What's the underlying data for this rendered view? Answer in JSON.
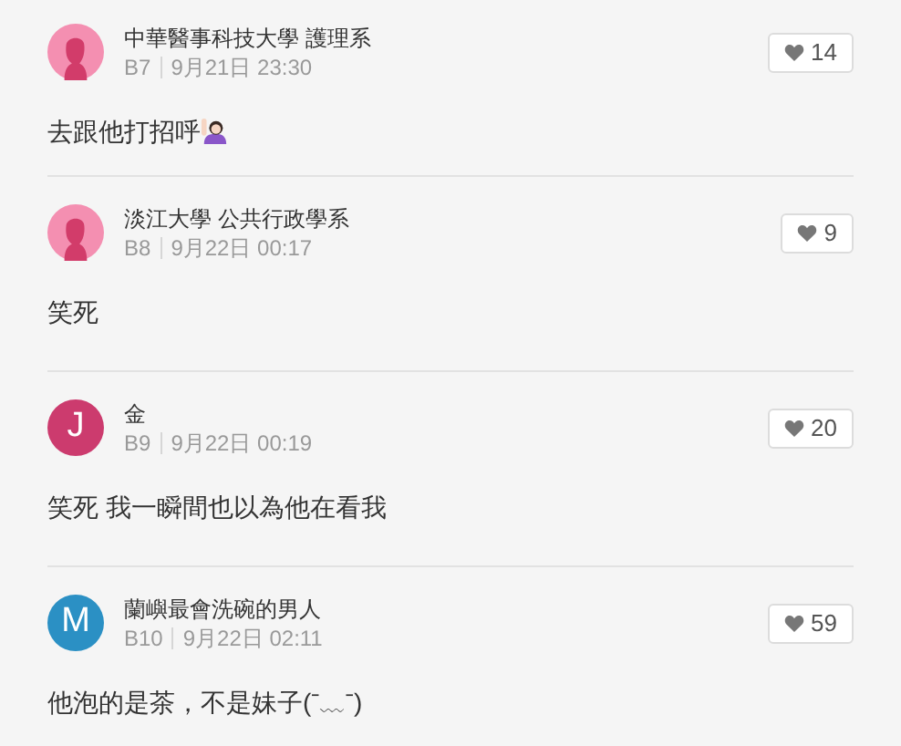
{
  "comments": [
    {
      "avatar": {
        "kind": "silhouette",
        "color": "#f48fb1"
      },
      "author": "中華醫事科技大學 護理系",
      "floor": "B7",
      "time": "9月21日 23:30",
      "likes": "14",
      "text": "去跟他打招呼",
      "has_emoji": true
    },
    {
      "avatar": {
        "kind": "silhouette",
        "color": "#f48fb1"
      },
      "author": "淡江大學 公共行政學系",
      "floor": "B8",
      "time": "9月22日 00:17",
      "likes": "9",
      "text": "笑死"
    },
    {
      "avatar": {
        "kind": "letter",
        "letter": "J",
        "color": "#cc3b6e"
      },
      "author": "金",
      "floor": "B9",
      "time": "9月22日 00:19",
      "likes": "20",
      "text": "笑死 我一瞬間也以為他在看我"
    },
    {
      "avatar": {
        "kind": "letter",
        "letter": "M",
        "color": "#2b90c4"
      },
      "author": "蘭嶼最會洗碗的男人",
      "floor": "B10",
      "time": "9月22日 02:11",
      "likes": "59",
      "text": "他泡的是茶，不是妹子(ˉ﹏ˉ)"
    }
  ]
}
